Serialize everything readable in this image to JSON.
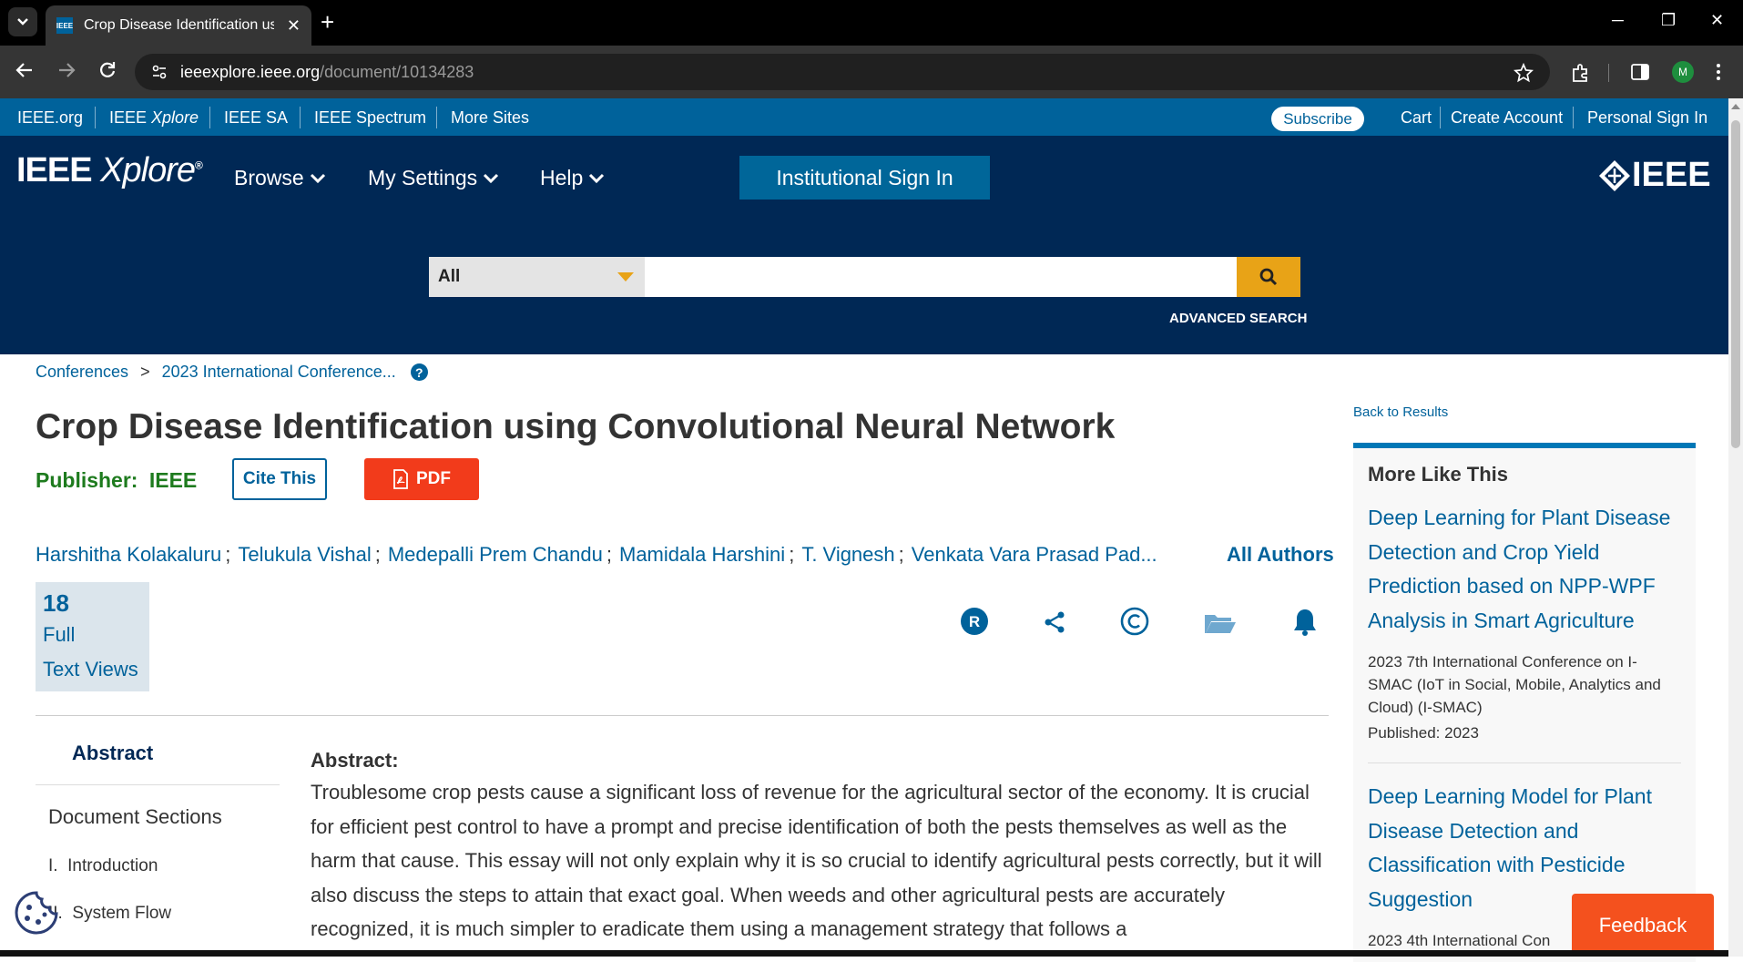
{
  "browser": {
    "tab_title": "Crop Disease Identification using Convolutional Neural Network",
    "favicon_text": "IEEE",
    "url_host": "ieeexplore.ieee.org",
    "url_path": "/document/10134283",
    "profile_initial": "M"
  },
  "meta_nav": {
    "ieee_org": "IEEE.org",
    "xplore_prefix": "IEEE ",
    "xplore_italic": "Xplore",
    "ieee_sa": "IEEE SA",
    "ieee_spectrum": "IEEE Spectrum",
    "more_sites": "More Sites",
    "subscribe": "Subscribe",
    "cart": "Cart",
    "create_account": "Create Account",
    "personal_sign_in": "Personal Sign In"
  },
  "header": {
    "logo_bold": "IEEE",
    "logo_italic": "Xplore",
    "logo_reg": "®",
    "browse": "Browse",
    "my_settings": "My Settings",
    "help": "Help",
    "institutional_sign_in": "Institutional Sign In",
    "ieee_brand": "IEEE",
    "search_scope": "All",
    "search_placeholder": "",
    "advanced_search": "ADVANCED SEARCH"
  },
  "breadcrumb": {
    "conferences": "Conferences",
    "separator": ">",
    "conference": "2023 International Conference...",
    "help": "?"
  },
  "document": {
    "title": "Crop Disease Identification using Convolutional Neural Network",
    "publisher_label": "Publisher:",
    "publisher": "IEEE",
    "cite_this": "Cite This",
    "pdf": "PDF",
    "authors": [
      "Harshitha Kolakaluru",
      "Telukula Vishal",
      "Medepalli Prem Chandu",
      "Mamidala Harshini",
      "T. Vignesh",
      "Venkata Vara Prasad Pad..."
    ],
    "author_separator": ";",
    "all_authors": "All Authors",
    "views_count": "18",
    "views_label_1": "Full",
    "views_label_2": "Text Views"
  },
  "sidenav": {
    "abstract": "Abstract",
    "document_sections": "Document Sections",
    "items": [
      {
        "num": "I.",
        "label": "Introduction"
      },
      {
        "num": "II.",
        "label": "System Flow"
      }
    ]
  },
  "abstract": {
    "label": "Abstract:",
    "text": "Troublesome crop pests cause a significant loss of revenue for the agricultural sector of the economy. It is crucial for efficient pest control to have a prompt and precise identification of both the pests themselves as well as the harm that cause. This essay will not only explain why it is so crucial to identify agricultural pests correctly, but it will also discuss the steps to attain that exact goal. When weeds and other agricultural pests are accurately recognized, it is much simpler to eradicate them using a management strategy that follows a"
  },
  "more_like_this": {
    "back_to_results": "Back to Results",
    "heading": "More Like This",
    "items": [
      {
        "title": "Deep Learning for Plant Disease Detection and Crop Yield Prediction based on NPP-WPF Analysis in Smart Agriculture",
        "venue": "2023 7th International Conference on I-SMAC (IoT in Social, Mobile, Analytics and Cloud) (I-SMAC)",
        "published": "Published: 2023"
      },
      {
        "title": "Deep Learning Model for Plant Disease Detection and Classification with Pesticide Suggestion",
        "venue": "2023 4th International Con",
        "published": ""
      }
    ]
  },
  "feedback": "Feedback",
  "colors": {
    "ieee_blue": "#00629b",
    "header_navy": "#002855",
    "search_gold": "#e8a317",
    "pdf_red": "#f23b1b",
    "publisher_green": "#1e7b1e",
    "feedback_orange": "#f4511e"
  }
}
